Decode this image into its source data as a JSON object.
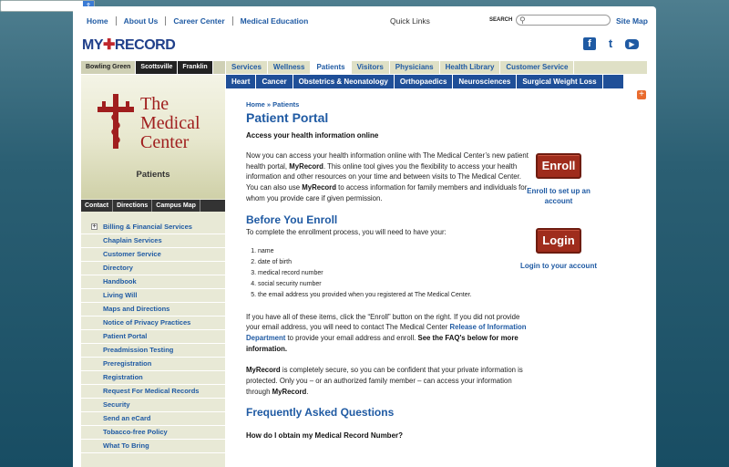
{
  "top_nav": {
    "items": [
      "Home",
      "About Us",
      "Career Center",
      "Medical Education"
    ],
    "quick_links": "Quick Links",
    "search_label": "SEARCH",
    "search_placeholder": "",
    "site_map": "Site Map"
  },
  "logo": {
    "text_my": "MY",
    "text_record": "RECORD"
  },
  "social": {
    "facebook": "f",
    "twitter": "t",
    "youtube": "▶"
  },
  "campus_tabs": [
    "Bowling Green",
    "Scottsville",
    "Franklin"
  ],
  "main_nav": [
    "Services",
    "Wellness",
    "Patients",
    "Visitors",
    "Physicians",
    "Health Library",
    "Customer Service"
  ],
  "main_nav_active": "Patients",
  "sub_nav": [
    "Heart",
    "Cancer",
    "Obstetrics & Neonatology",
    "Orthopaedics",
    "Neurosciences",
    "Surgical Weight Loss"
  ],
  "brand": {
    "line1": "The",
    "line2": "Medical",
    "line3": "Center",
    "subtitle": "Patients"
  },
  "side_tabs": [
    "Contact",
    "Directions",
    "Campus Map"
  ],
  "sidebar": {
    "items": [
      "Billing & Financial Services",
      "Chaplain Services",
      "Customer Service",
      "Directory",
      "Handbook",
      "Living Will",
      "Maps and Directions",
      "Notice of Privacy Practices",
      "Patient Portal",
      "Preadmission Testing",
      "Preregistration",
      "Registration",
      "Request For Medical Records",
      "Security",
      "Send an eCard",
      "Tobacco-free Policy",
      "What To Bring"
    ]
  },
  "content": {
    "breadcrumb": "Home » Patients",
    "title": "Patient Portal",
    "lead": "Access your health information online",
    "intro_1": "Now you can access your health information online with The Medical Center’s new patient health portal, ",
    "intro_bold_1": "MyRecord",
    "intro_2": ". This online tool gives you the flexibility to access your health information and other resources on your time and between visits to The Medical Center. You can also use ",
    "intro_bold_2": "MyRecord",
    "intro_3": " to access information for family members and individuals for whom you provide care if given permission.",
    "before_heading": "Before You Enroll",
    "before_sub": "To complete the enrollment process, you will need to have your:",
    "requirements": [
      "name",
      "date of birth",
      "medical record number",
      "social security number",
      "the email address you provided when you registered at The Medical Center."
    ],
    "after_1": "If you have all of these items, click the “Enroll” button on the right. If you did not provide your email address, you will need to contact The Medical Center ",
    "after_link": "Release of Information Department",
    "after_2": " to provide your email address and enroll. ",
    "after_bold": "See the FAQ's below for more information.",
    "secure_bold_1": "MyRecord",
    "secure_1": " is completely secure, so you can be confident that your private information is protected. Only you – or an authorized family member – can access your information through ",
    "secure_bold_2": "MyRecord",
    "secure_2": ".",
    "faq_heading": "Frequently Asked Questions",
    "faq_q1": "How do I obtain my Medical Record Number?"
  },
  "right": {
    "enroll_button": "Enroll",
    "enroll_link": "Enroll to set up an account",
    "login_button": "Login",
    "login_link": "Login to your account"
  },
  "colors": {
    "link_blue": "#1f5aa3",
    "button_red": "#9f2c1c",
    "subnav_blue": "#1f4f98",
    "accent_orange": "#e96b2e"
  }
}
